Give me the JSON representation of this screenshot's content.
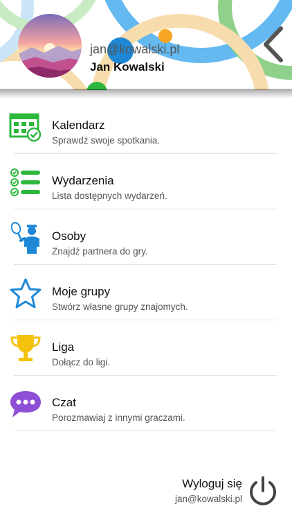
{
  "header": {
    "email": "jan@kowalski.pl",
    "name": "Jan Kowalski"
  },
  "menu": [
    {
      "title": "Kalendarz",
      "subtitle": "Sprawdź swoje spotkania.",
      "icon": "calendar-check-icon",
      "color": "#2db83d"
    },
    {
      "title": "Wydarzenia",
      "subtitle": "Lista dostępnych wydarzeń.",
      "icon": "checklist-icon",
      "color": "#2db83d"
    },
    {
      "title": "Osoby",
      "subtitle": "Znajdź partnera do gry.",
      "icon": "tennis-player-icon",
      "color": "#1e88d6"
    },
    {
      "title": "Moje grupy",
      "subtitle": "Stwórz własne grupy znajomych.",
      "icon": "star-icon",
      "color": "#1e88d6"
    },
    {
      "title": "Liga",
      "subtitle": "Dołącz do ligi.",
      "icon": "trophy-icon",
      "color": "#f4c20d"
    },
    {
      "title": "Czat",
      "subtitle": "Porozmawiaj z innymi graczami.",
      "icon": "chat-bubble-icon",
      "color": "#8e4fd6"
    }
  ],
  "footer": {
    "logout_label": "Wyloguj się",
    "email": "jan@kowalski.pl"
  },
  "colors": {
    "green": "#2db83d",
    "blue": "#1e88d6",
    "yellow": "#f4c20d",
    "purple": "#8e4fd6",
    "header_arc_blue": "#63b9f0",
    "header_arc_green": "#8fd18a",
    "header_arc_orange": "#f7dcae"
  }
}
